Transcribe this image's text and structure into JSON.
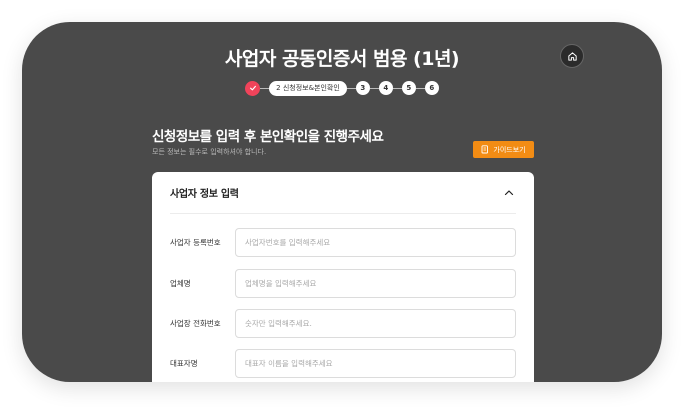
{
  "header": {
    "title": "사업자 공동인증서 범용 (1년)"
  },
  "stepper": {
    "current_label": "2 신청정보&본인확인",
    "next_steps": [
      "3",
      "4",
      "5",
      "6"
    ]
  },
  "intro": {
    "heading": "신청정보를 입력 후 본인확인을 진행주세요",
    "subheading": "모든 정보는 필수로 입력하셔야 합니다.",
    "guide_label": "가이드보기"
  },
  "form": {
    "section_title": "사업자 정보 입력",
    "fields": [
      {
        "label": "사업자 등록번호",
        "placeholder": "사업자번호를 입력해주세요"
      },
      {
        "label": "업체명",
        "placeholder": "업체명을 입력해주세요"
      },
      {
        "label": "사업장 전화번호",
        "placeholder": "숫자만 입력해주세요."
      },
      {
        "label": "대표자명",
        "placeholder": "대표자 이름을 입력해주세요"
      }
    ]
  },
  "colors": {
    "background": "#4a4a4a",
    "accent_red": "#f0435a",
    "guide_orange": "#f28c14"
  },
  "icons": {
    "home": "home-icon",
    "check": "check-icon",
    "guide": "document-icon",
    "collapse": "chevron-up-icon"
  }
}
